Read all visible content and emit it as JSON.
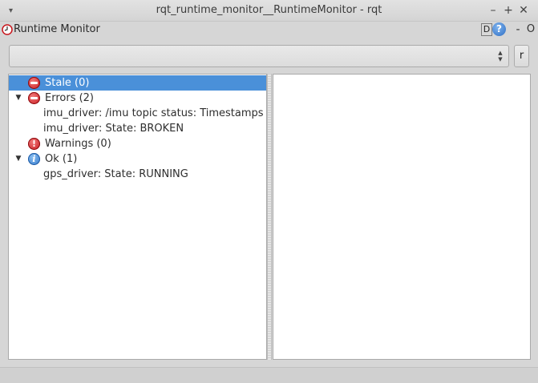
{
  "window": {
    "title": "rqt_runtime_monitor__RuntimeMonitor - rqt",
    "controls": {
      "menu": "▾",
      "minimize": "–",
      "maximize": "+",
      "close": "✕"
    }
  },
  "plugin": {
    "title": "Runtime Monitor",
    "icon": "clock-icon",
    "buttons": {
      "d": "D",
      "help": "?",
      "minus": "-",
      "o": "O"
    }
  },
  "toolbar": {
    "combo_value": "",
    "refresh_label": "r"
  },
  "tree": [
    {
      "label": "Stale (0)",
      "icon": "stop-icon",
      "expanded": false,
      "selected": true,
      "children": []
    },
    {
      "label": "Errors (2)",
      "icon": "stop-icon",
      "expanded": true,
      "selected": false,
      "children": [
        "imu_driver: /imu topic status: Timestamps t...",
        "imu_driver: State: BROKEN"
      ]
    },
    {
      "label": "Warnings (0)",
      "icon": "exclamation-icon",
      "expanded": false,
      "selected": false,
      "children": []
    },
    {
      "label": "Ok (1)",
      "icon": "info-icon",
      "expanded": true,
      "selected": false,
      "children": [
        "gps_driver: State: RUNNING"
      ]
    }
  ],
  "colors": {
    "selection": "#4a90d9",
    "error_red": "#c8161c",
    "info_blue": "#2f74c9"
  }
}
